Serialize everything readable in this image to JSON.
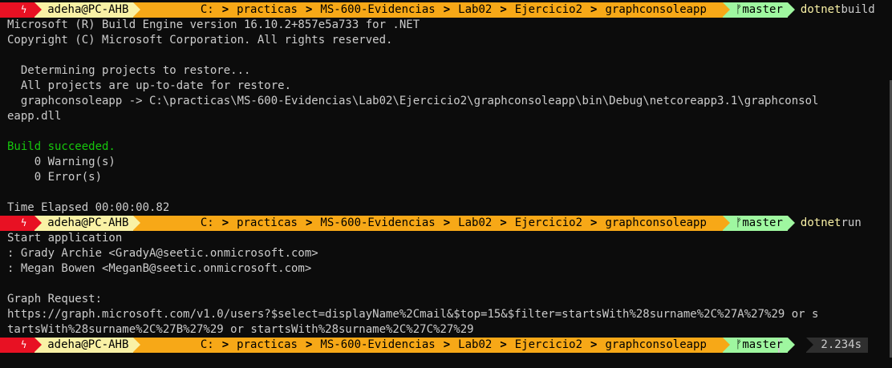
{
  "prompt": {
    "bolt": "ϟ",
    "user": "adeha@PC-AHB",
    "path": [
      "C:",
      "practicas",
      "MS-600-Evidencias",
      "Lab02",
      "Ejercicio2",
      "graphconsoleapp"
    ],
    "git_icon": "ᚠ",
    "branch": "master"
  },
  "commands": {
    "build": {
      "cmd": "dotnet",
      "arg": "build"
    },
    "run": {
      "cmd": "dotnet",
      "arg": "run"
    }
  },
  "output": {
    "build": [
      "Microsoft (R) Build Engine version 16.10.2+857e5a733 for .NET",
      "Copyright (C) Microsoft Corporation. All rights reserved.",
      "",
      "  Determining projects to restore...",
      "  All projects are up-to-date for restore.",
      "  graphconsoleapp -> C:\\practicas\\MS-600-Evidencias\\Lab02\\Ejercicio2\\graphconsoleapp\\bin\\Debug\\netcoreapp3.1\\graphconsol",
      "eapp.dll",
      "",
      "Build succeeded.",
      "    0 Warning(s)",
      "    0 Error(s)",
      "",
      "Time Elapsed 00:00:00.82"
    ],
    "run": [
      "Start application",
      ": Grady Archie <GradyA@seetic.onmicrosoft.com>",
      ": Megan Bowen <MeganB@seetic.onmicrosoft.com>",
      "",
      "Graph Request:",
      "https://graph.microsoft.com/v1.0/users?$select=displayName%2Cmail&$top=15&$filter=startsWith%28surname%2C%27A%27%29 or s",
      "tartsWith%28surname%2C%27B%27%29 or startsWith%28surname%2C%27C%27%29"
    ]
  },
  "timer": "2.234s",
  "colors": {
    "background": "#0c0c0c",
    "success": "#16c60c",
    "path_segment": "#f7a817",
    "user_segment": "#f9f1a5",
    "git_segment": "#9ff7a0",
    "error_segment": "#e81123"
  }
}
